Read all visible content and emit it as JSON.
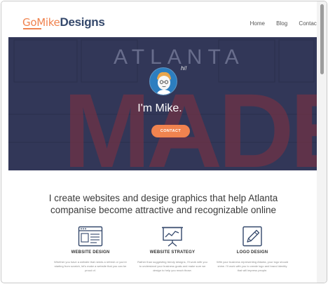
{
  "logo": {
    "part1": "GoMike",
    "part2": "Designs"
  },
  "nav": {
    "items": [
      "Home",
      "Blog",
      "Contact"
    ]
  },
  "hero": {
    "bg_word_top": "ATLANTA",
    "bg_word_big": "MADE",
    "greeting": "hi!",
    "title": "I'm Mike.",
    "button": "CONTACT"
  },
  "intro": {
    "line1": "I create websites and desige graphics that help Atlanta",
    "line2": "companise become attractive and recognizable online"
  },
  "services": [
    {
      "icon": "website-layout-icon",
      "title": "WEBSITE DESIGN",
      "desc": "Whether you have a website that needs a refresh or you're starting from scratch, let's make a website that you can be proud of."
    },
    {
      "icon": "presentation-chart-icon",
      "title": "WEBSITE STRATEGY",
      "desc": "Rather than suggesting trendy designs, I'll work with you to understand your business goals and make sure we design to help you reach those."
    },
    {
      "icon": "pencil-edit-icon",
      "title": "LOGO DESIGN",
      "desc": "With your business representing Atlanta, your logo should shine. I'll work with you to create logo and brand identity that will impress people."
    }
  ],
  "colors": {
    "accent": "#f0834f",
    "brand": "#34486b",
    "hero_overlay": "#35395a",
    "hero_text_red": "#8a3243"
  }
}
